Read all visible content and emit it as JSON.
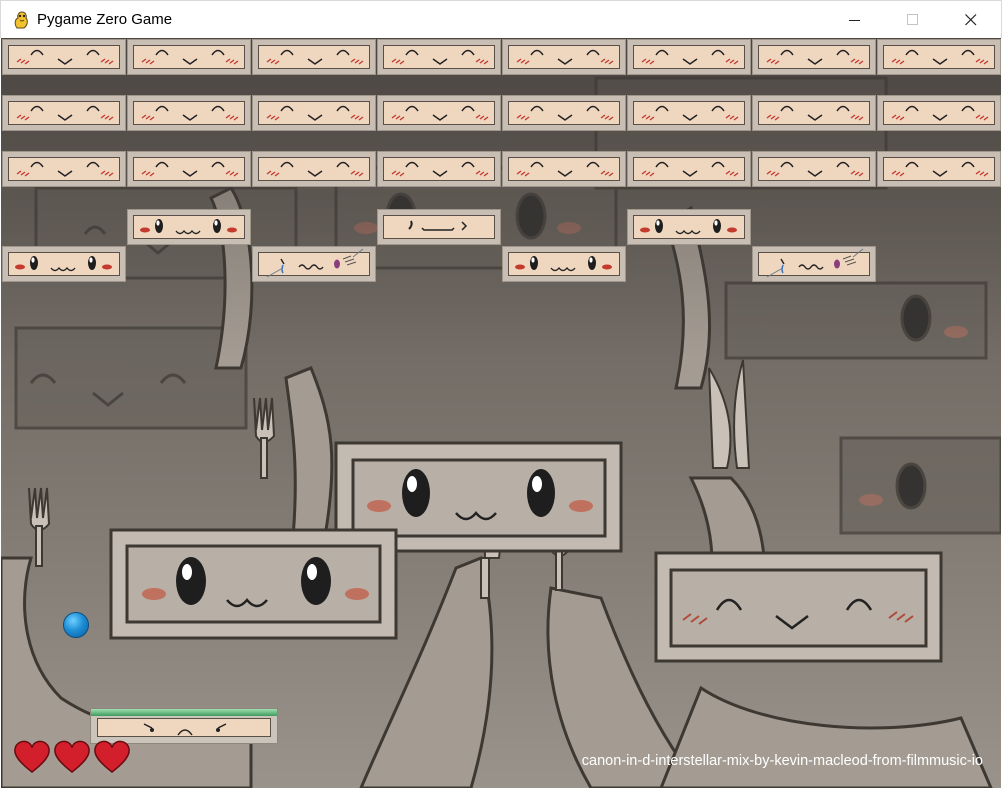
{
  "window": {
    "title": "Pygame Zero Game"
  },
  "game": {
    "bricks": [
      {
        "row": 0,
        "col": 0,
        "face": "happy"
      },
      {
        "row": 0,
        "col": 1,
        "face": "happy"
      },
      {
        "row": 0,
        "col": 2,
        "face": "happy"
      },
      {
        "row": 0,
        "col": 3,
        "face": "happy"
      },
      {
        "row": 0,
        "col": 4,
        "face": "happy"
      },
      {
        "row": 0,
        "col": 5,
        "face": "happy"
      },
      {
        "row": 0,
        "col": 6,
        "face": "happy"
      },
      {
        "row": 0,
        "col": 7,
        "face": "happy"
      },
      {
        "row": 1,
        "col": 0,
        "face": "happy"
      },
      {
        "row": 1,
        "col": 1,
        "face": "happy"
      },
      {
        "row": 1,
        "col": 2,
        "face": "happy"
      },
      {
        "row": 1,
        "col": 3,
        "face": "happy"
      },
      {
        "row": 1,
        "col": 4,
        "face": "happy"
      },
      {
        "row": 1,
        "col": 5,
        "face": "happy"
      },
      {
        "row": 1,
        "col": 6,
        "face": "happy"
      },
      {
        "row": 1,
        "col": 7,
        "face": "happy"
      },
      {
        "row": 2,
        "col": 0,
        "face": "happy"
      },
      {
        "row": 2,
        "col": 1,
        "face": "happy"
      },
      {
        "row": 2,
        "col": 2,
        "face": "happy"
      },
      {
        "row": 2,
        "col": 3,
        "face": "happy"
      },
      {
        "row": 2,
        "col": 4,
        "face": "happy"
      },
      {
        "row": 2,
        "col": 5,
        "face": "happy"
      },
      {
        "row": 2,
        "col": 6,
        "face": "happy"
      },
      {
        "row": 2,
        "col": 7,
        "face": "happy"
      },
      {
        "row": 3,
        "col": 1,
        "face": "eyes"
      },
      {
        "row": 3,
        "col": 3,
        "face": "annoyed"
      },
      {
        "row": 3,
        "col": 5,
        "face": "eyes"
      },
      {
        "row": 4,
        "col": 0,
        "face": "eyes"
      },
      {
        "row": 4,
        "col": 2,
        "face": "crying"
      },
      {
        "row": 4,
        "col": 4,
        "face": "eyes"
      },
      {
        "row": 4,
        "col": 6,
        "face": "crying"
      }
    ],
    "paddle_face": "angry",
    "lives": 3,
    "music_credit": "canon-in-d-interstellar-mix-by-kevin-macleod-from-filmmusic-io"
  }
}
